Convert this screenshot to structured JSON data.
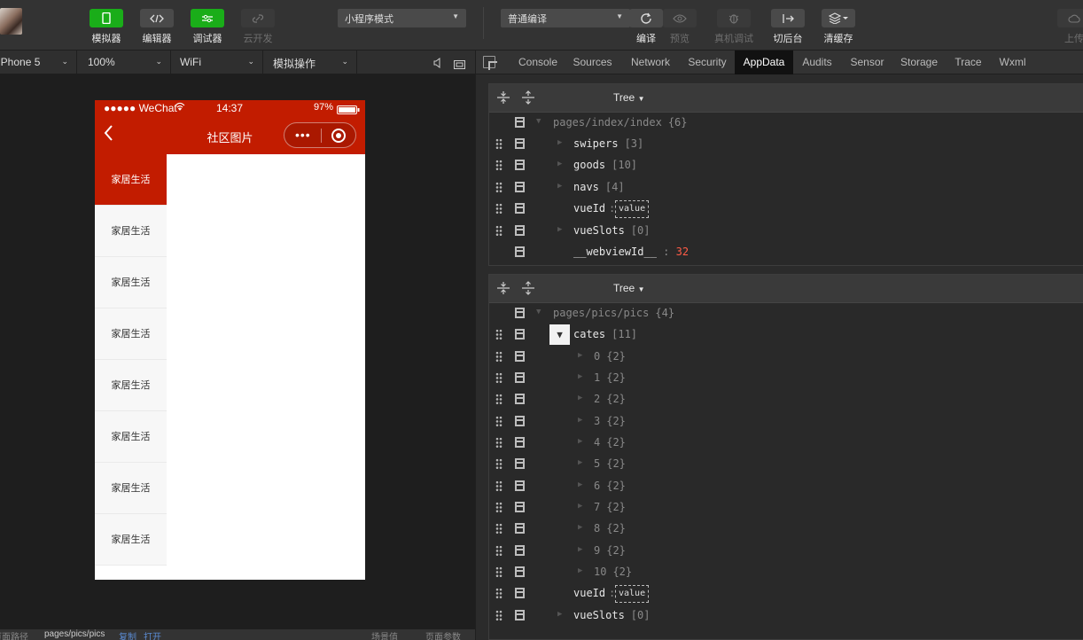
{
  "toolbar": {
    "simulator": "模拟器",
    "editor": "编辑器",
    "debugger": "调试器",
    "cloud": "云开发",
    "mode_select": "小程序模式",
    "compile_select": "普通编译",
    "compile": "编译",
    "preview": "预览",
    "remote_debug": "真机调试",
    "background": "切后台",
    "clear_cache": "清缓存",
    "upload": "上传"
  },
  "simbar": {
    "device": "iPhone 5",
    "zoom": "100%",
    "network": "WiFi",
    "operation": "模拟操作"
  },
  "phone": {
    "carrier": "●●●●● WeChat",
    "time": "14:37",
    "battery": "97%",
    "title": "社区图片",
    "cates": [
      "家居生活",
      "家居生活",
      "家居生活",
      "家居生活",
      "家居生活",
      "家居生活",
      "家居生活",
      "家居生活"
    ]
  },
  "bottombar": {
    "path_label": "页面路径",
    "path": "pages/pics/pics",
    "copy": "复制",
    "open": "打开",
    "scene": "场景值",
    "params": "页面参数"
  },
  "devtools": {
    "tabs": [
      "Console",
      "Sources",
      "Network",
      "Security",
      "AppData",
      "Audits",
      "Sensor",
      "Storage",
      "Trace",
      "Wxml"
    ],
    "active_tab": "AppData",
    "tree_label": "Tree",
    "panel1": {
      "root": "pages/index/index",
      "root_count": "{6}",
      "rows": [
        {
          "key": "swipers",
          "count": "[3]"
        },
        {
          "key": "goods",
          "count": "[10]"
        },
        {
          "key": "navs",
          "count": "[4]"
        },
        {
          "key": "vueId",
          "value": "value"
        },
        {
          "key": "vueSlots",
          "count": "[0]"
        },
        {
          "key": "__webviewId__",
          "num": "32"
        }
      ]
    },
    "panel2": {
      "root": "pages/pics/pics",
      "root_count": "{4}",
      "cates_key": "cates",
      "cates_count": "[11]",
      "items": [
        "0",
        "1",
        "2",
        "3",
        "4",
        "5",
        "6",
        "7",
        "8",
        "9",
        "10"
      ],
      "item_count": "{2}",
      "vueId_key": "vueId",
      "vueId_value": "value",
      "vueSlots_key": "vueSlots",
      "vueSlots_count": "[0]"
    }
  }
}
